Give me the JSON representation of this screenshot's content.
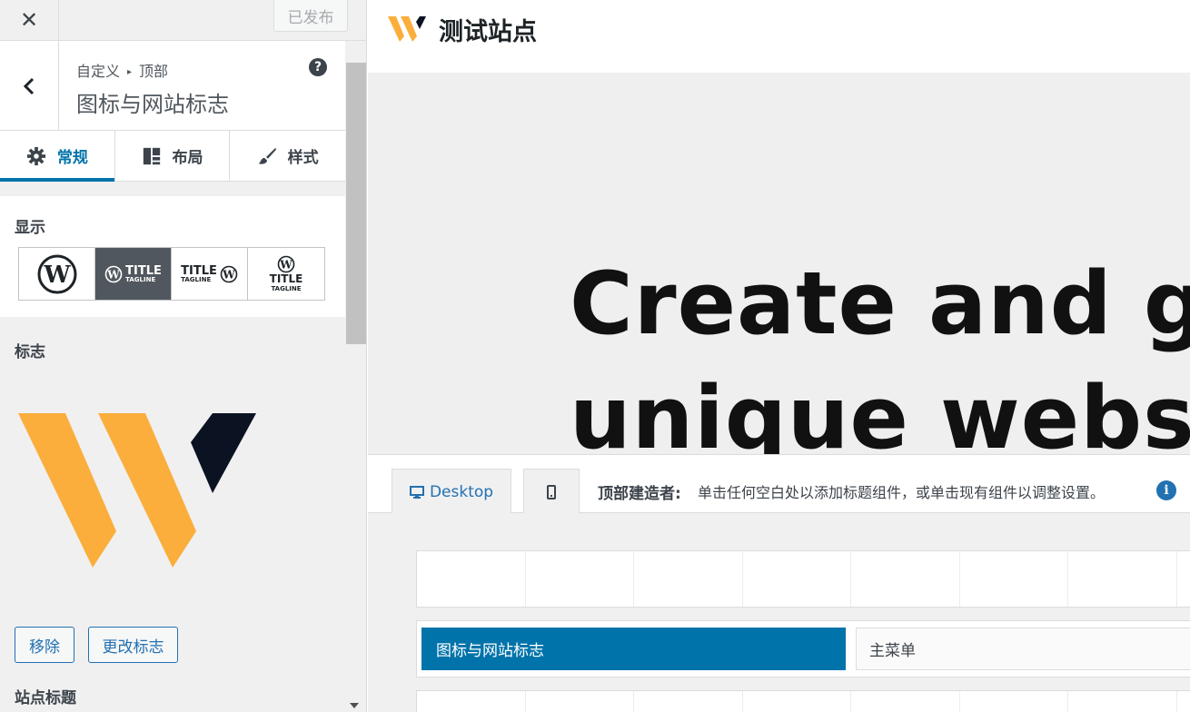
{
  "topbar": {
    "close_glyph": "✕",
    "publish_label": "已发布"
  },
  "section": {
    "breadcrumb_root": "自定义",
    "breadcrumb_sep": "▸",
    "breadcrumb_current": "顶部",
    "title": "图标与网站标志",
    "help_glyph": "?"
  },
  "tabs": [
    {
      "label": "常规",
      "icon": "gear-icon",
      "active": true
    },
    {
      "label": "布局",
      "icon": "layout-icon",
      "active": false
    },
    {
      "label": "样式",
      "icon": "brush-icon",
      "active": false
    }
  ],
  "display": {
    "label": "显示",
    "options": [
      {
        "name": "logo-only",
        "selected": false
      },
      {
        "name": "logo-title-tagline",
        "text_title": "TITLE",
        "text_tagline": "TAGLINE",
        "selected": true
      },
      {
        "name": "title-tagline-logo",
        "text_title": "TITLE",
        "text_tagline": "TAGLINE",
        "selected": false
      },
      {
        "name": "logo-above-title",
        "text_title": "TITLE",
        "text_tagline": "TAGLINE",
        "selected": false
      }
    ]
  },
  "logo": {
    "label": "标志",
    "remove_label": "移除",
    "change_label": "更改标志"
  },
  "site_title_label": "站点标题",
  "preview": {
    "site_name": "测试站点",
    "hero_line_1": "Create and gro",
    "hero_line_2": "unique website"
  },
  "builder": {
    "desktop_label": "Desktop",
    "title": "顶部建造者:",
    "description": "单击任何空白处以添加标题组件，或单击现有组件以调整设置。",
    "info_glyph": "i",
    "component_logo": "图标与网站标志",
    "component_menu": "主菜单"
  },
  "colors": {
    "accent": "#0073aa",
    "logo_yellow": "#fbae3c",
    "logo_dark": "#0b1222"
  }
}
